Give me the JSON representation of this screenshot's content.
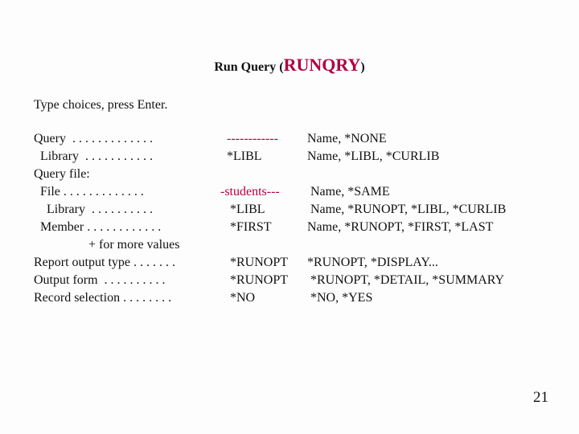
{
  "title": {
    "prefix": "Run Query (",
    "cmd": "RUNQRY",
    "suffix": ")"
  },
  "instruction": "Type choices, press Enter.",
  "rows": [
    {
      "label": "Query  . . . . . . . . . . . . .",
      "value": "  ------------",
      "help": "Name, *NONE"
    },
    {
      "label": "  Library  . . . . . . . . . . .",
      "value": "  *LIBL",
      "help": "Name, *LIBL, *CURLIB"
    },
    {
      "label": "Query file:",
      "value": "",
      "help": ""
    },
    {
      "label": "  File . . . . . . . . . . . . .",
      "value": "-students---",
      "help": " Name, *SAME"
    },
    {
      "label": "    Library  . . . . . . . . . .",
      "value": "   *LIBL",
      "help": " Name, *RUNOPT, *LIBL, *CURLIB"
    },
    {
      "label": "  Member . . . . . . . . . . . .",
      "value": "   *FIRST",
      "help": "Name, *RUNOPT, *FIRST, *LAST"
    },
    {
      "label": "                 + for more values",
      "value": "",
      "help": ""
    },
    {
      "label": "Report output type . . . . . . .",
      "value": "   *RUNOPT",
      "help": "*RUNOPT, *DISPLAY..."
    },
    {
      "label": "Output form  . . . . . . . . . .",
      "value": "   *RUNOPT",
      "help": " *RUNOPT, *DETAIL, *SUMMARY"
    },
    {
      "label": "Record selection . . . . . . . .",
      "value": "   *NO",
      "help": " *NO, *YES"
    }
  ],
  "value_is_red": [
    true,
    false,
    false,
    true,
    false,
    false,
    false,
    false,
    false,
    false
  ],
  "page_number": "21"
}
